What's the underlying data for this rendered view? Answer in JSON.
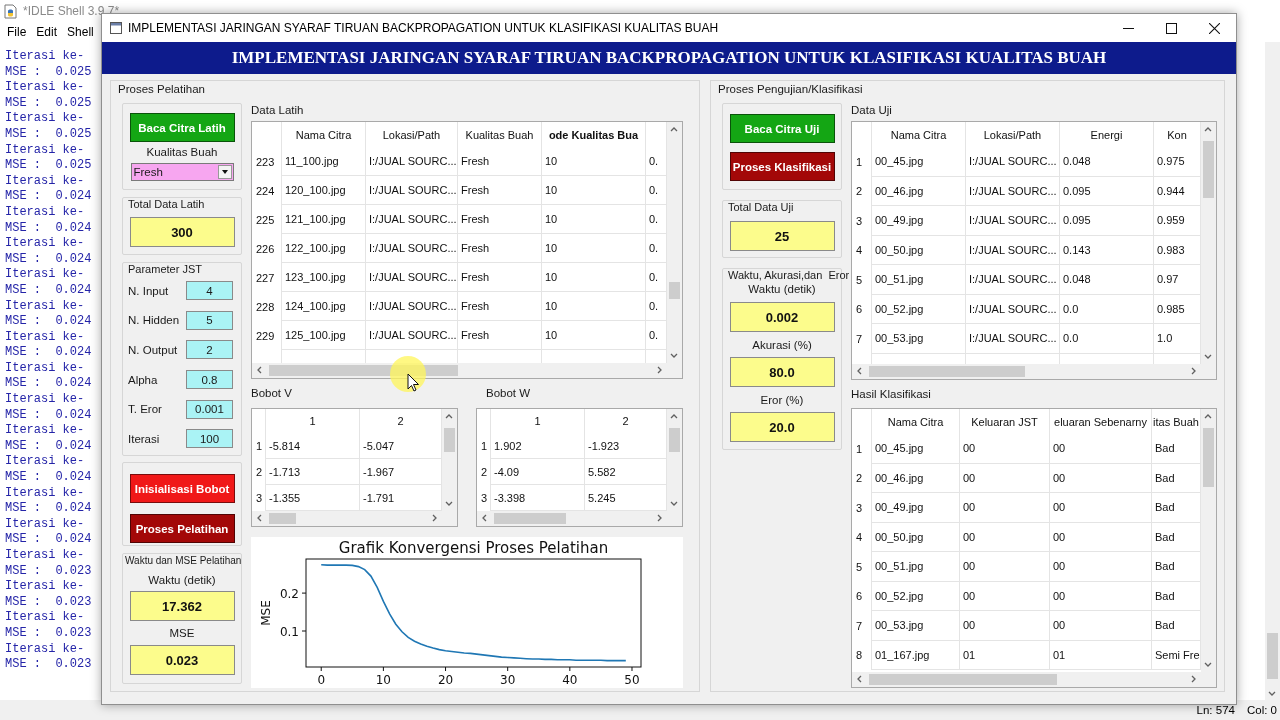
{
  "idle_window": {
    "title": "*IDLE Shell 3.9.7*",
    "menu": [
      "File",
      "Edit",
      "Shell"
    ],
    "output_lines": [
      "Iterasi ke-",
      "MSE :  0.025",
      "Iterasi ke-",
      "MSE :  0.025",
      "Iterasi ke-",
      "MSE :  0.025",
      "Iterasi ke-",
      "MSE :  0.025",
      "Iterasi ke-",
      "MSE :  0.024",
      "Iterasi ke-",
      "MSE :  0.024",
      "Iterasi ke-",
      "MSE :  0.024",
      "Iterasi ke-",
      "MSE :  0.024",
      "Iterasi ke-",
      "MSE :  0.024",
      "Iterasi ke-",
      "MSE :  0.024",
      "Iterasi ke-",
      "MSE :  0.024",
      "Iterasi ke-",
      "MSE :  0.024",
      "Iterasi ke-",
      "MSE :  0.024",
      "Iterasi ke-",
      "MSE :  0.024",
      "Iterasi ke-",
      "MSE :  0.024",
      "Iterasi ke-",
      "MSE :  0.024",
      "Iterasi ke-",
      "MSE :  0.023",
      "Iterasi ke-",
      "MSE :  0.023",
      "Iterasi ke-",
      "MSE :  0.023",
      "Iterasi ke-",
      "MSE :  0.023"
    ],
    "status_bar": [
      "Ln: 574",
      "Col: 0"
    ]
  },
  "window": {
    "title": "IMPLEMENTASI JARINGAN SYARAF TIRUAN BACKPROPAGATION UNTUK KLASIFIKASI KUALITAS BUAH",
    "banner": "IMPLEMENTASI JARINGAN SYARAF TIRUAN BACKPROPAGATION UNTUK KLASIFIKASI KUALITAS BUAH"
  },
  "training": {
    "title": "Proses Pelatihan",
    "buttons": [
      {
        "label": "Baca Citra Latih",
        "color": "#14a614"
      },
      {
        "label": "Inisialisasi Bobot",
        "color": "#f01818"
      },
      {
        "label": "Proses Pelatihan",
        "color": "#a30808"
      }
    ],
    "quality": {
      "label": "Kualitas Buah",
      "value": "Fresh"
    },
    "total": {
      "label": "Total Data Latih",
      "value": "300"
    },
    "parameters": {
      "title": "Parameter JST",
      "items": [
        {
          "label": "N. Input",
          "value": "4"
        },
        {
          "label": "N. Hidden",
          "value": "5"
        },
        {
          "label": "N. Output",
          "value": "2"
        },
        {
          "label": "Alpha",
          "value": "0.8"
        },
        {
          "label": "T. Eror",
          "value": "0.001"
        },
        {
          "label": "Iterasi",
          "value": "100"
        }
      ]
    },
    "results": {
      "title": "Waktu dan MSE Pelatihan",
      "items": [
        {
          "label": "Waktu (detik)",
          "value": "17.362"
        },
        {
          "label": "MSE",
          "value": "0.023"
        }
      ]
    },
    "data_table": {
      "title": "Data Latih",
      "columns": [
        {
          "label": "Nama Citra",
          "bold": false
        },
        {
          "label": "Lokasi/Path",
          "bold": false
        },
        {
          "label": "Kualitas Buah",
          "bold": false
        },
        {
          "label": "ode Kualitas Bua",
          "bold": true
        }
      ],
      "rows": [
        {
          "index": "223",
          "cells": [
            "11_100.jpg",
            "I:/JUAL SOURC...",
            "Fresh",
            "10",
            "0."
          ]
        },
        {
          "index": "224",
          "cells": [
            "120_100.jpg",
            "I:/JUAL SOURC...",
            "Fresh",
            "10",
            "0."
          ]
        },
        {
          "index": "225",
          "cells": [
            "121_100.jpg",
            "I:/JUAL SOURC...",
            "Fresh",
            "10",
            "0."
          ]
        },
        {
          "index": "226",
          "cells": [
            "122_100.jpg",
            "I:/JUAL SOURC...",
            "Fresh",
            "10",
            "0."
          ]
        },
        {
          "index": "227",
          "cells": [
            "123_100.jpg",
            "I:/JUAL SOURC...",
            "Fresh",
            "10",
            "0."
          ]
        },
        {
          "index": "228",
          "cells": [
            "124_100.jpg",
            "I:/JUAL SOURC...",
            "Fresh",
            "10",
            "0."
          ]
        },
        {
          "index": "229",
          "cells": [
            "125_100.jpg",
            "I:/JUAL SOURC...",
            "Fresh",
            "10",
            "0."
          ]
        }
      ]
    },
    "weights_v": {
      "title": "Bobot V",
      "columns": [
        {
          "label": "1",
          "bold": false
        },
        {
          "label": "2",
          "bold": false
        }
      ],
      "rows": [
        {
          "index": "1",
          "cells": [
            "-5.814",
            "-5.047"
          ]
        },
        {
          "index": "2",
          "cells": [
            "-1.713",
            "-1.967"
          ]
        },
        {
          "index": "3",
          "cells": [
            "-1.355",
            "-1.791"
          ]
        }
      ]
    },
    "weights_w": {
      "title": "Bobot W",
      "columns": [
        {
          "label": "1",
          "bold": false
        },
        {
          "label": "2",
          "bold": false
        }
      ],
      "rows": [
        {
          "index": "1",
          "cells": [
            "1.902",
            "-1.923"
          ]
        },
        {
          "index": "2",
          "cells": [
            "-4.09",
            "5.582"
          ]
        },
        {
          "index": "3",
          "cells": [
            "-3.398",
            "5.245"
          ]
        }
      ]
    },
    "chart": {
      "chart_data": {
        "type": "line",
        "title": "Grafik Konvergensi Proses Pelatihan",
        "ylabel": "MSE",
        "x": [
          0,
          1,
          2,
          3,
          4,
          5,
          6,
          7,
          8,
          9,
          10,
          11,
          12,
          13,
          14,
          15,
          16,
          17,
          18,
          19,
          20,
          21,
          22,
          23,
          24,
          25,
          26,
          27,
          28,
          29,
          30,
          31,
          32,
          33,
          34,
          35,
          36,
          37,
          38,
          39,
          40,
          41,
          42,
          43,
          44,
          45,
          46,
          47,
          48,
          49
        ],
        "xlim": [
          -2.45,
          51.45
        ],
        "ylim": [
          0.005,
          0.29
        ],
        "xticks": [
          0,
          10,
          20,
          30,
          40,
          50
        ],
        "yticks": [
          0.1,
          0.2
        ],
        "series": [
          {
            "color": "#1f77b4",
            "values": [
              0.275,
              0.274,
              0.274,
              0.274,
              0.274,
              0.273,
              0.27,
              0.262,
              0.245,
              0.215,
              0.178,
              0.145,
              0.118,
              0.098,
              0.083,
              0.073,
              0.066,
              0.06,
              0.055,
              0.051,
              0.048,
              0.046,
              0.044,
              0.042,
              0.041,
              0.039,
              0.037,
              0.035,
              0.033,
              0.031,
              0.03,
              0.029,
              0.028,
              0.027,
              0.026,
              0.026,
              0.025,
              0.025,
              0.024,
              0.024,
              0.024,
              0.023,
              0.023,
              0.023,
              0.023,
              0.023,
              0.022,
              0.022,
              0.022,
              0.022
            ]
          }
        ]
      }
    }
  },
  "testing": {
    "title": "Proses Pengujian/Klasifikasi",
    "buttons": [
      {
        "label": "Baca Citra Uji",
        "color": "#14a614"
      },
      {
        "label": "Proses Klasifikasi",
        "color": "#a30808"
      }
    ],
    "total": {
      "label": "Total Data Uji",
      "value": "25"
    },
    "results": {
      "title": "Waktu, Akurasi,dan  Eror",
      "items": [
        {
          "label": "Waktu (detik)",
          "value": "0.002"
        },
        {
          "label": "Akurasi (%)",
          "value": "80.0"
        },
        {
          "label": "Eror (%)",
          "value": "20.0"
        }
      ]
    },
    "data_table": {
      "title": "Data Uji",
      "columns": [
        {
          "label": "Nama Citra",
          "bold": false
        },
        {
          "label": "Lokasi/Path",
          "bold": false
        },
        {
          "label": "Energi",
          "bold": false
        },
        {
          "label": "Kon",
          "bold": false
        }
      ],
      "rows": [
        {
          "index": "1",
          "cells": [
            "00_45.jpg",
            "I:/JUAL SOURC...",
            "0.048",
            "0.975"
          ]
        },
        {
          "index": "2",
          "cells": [
            "00_46.jpg",
            "I:/JUAL SOURC...",
            "0.095",
            "0.944"
          ]
        },
        {
          "index": "3",
          "cells": [
            "00_49.jpg",
            "I:/JUAL SOURC...",
            "0.095",
            "0.959"
          ]
        },
        {
          "index": "4",
          "cells": [
            "00_50.jpg",
            "I:/JUAL SOURC...",
            "0.143",
            "0.983"
          ]
        },
        {
          "index": "5",
          "cells": [
            "00_51.jpg",
            "I:/JUAL SOURC...",
            "0.048",
            "0.97"
          ]
        },
        {
          "index": "6",
          "cells": [
            "00_52.jpg",
            "I:/JUAL SOURC...",
            "0.0",
            "0.985"
          ]
        },
        {
          "index": "7",
          "cells": [
            "00_53.jpg",
            "I:/JUAL SOURC...",
            "0.0",
            "1.0"
          ]
        }
      ]
    },
    "result_table": {
      "title": "Hasil Klasifikasi",
      "columns": [
        {
          "label": "Nama Citra",
          "bold": false
        },
        {
          "label": "Keluaran JST",
          "bold": false
        },
        {
          "label": "eluaran Sebenarny",
          "bold": false
        },
        {
          "label": "itas Buah",
          "bold": false
        }
      ],
      "rows": [
        {
          "index": "1",
          "cells": [
            "00_45.jpg",
            "00",
            "00",
            "Bad"
          ]
        },
        {
          "index": "2",
          "cells": [
            "00_46.jpg",
            "00",
            "00",
            "Bad"
          ]
        },
        {
          "index": "3",
          "cells": [
            "00_49.jpg",
            "00",
            "00",
            "Bad"
          ]
        },
        {
          "index": "4",
          "cells": [
            "00_50.jpg",
            "00",
            "00",
            "Bad"
          ]
        },
        {
          "index": "5",
          "cells": [
            "00_51.jpg",
            "00",
            "00",
            "Bad"
          ]
        },
        {
          "index": "6",
          "cells": [
            "00_52.jpg",
            "00",
            "00",
            "Bad"
          ]
        },
        {
          "index": "7",
          "cells": [
            "00_53.jpg",
            "00",
            "00",
            "Bad"
          ]
        },
        {
          "index": "8",
          "cells": [
            "01_167.jpg",
            "01",
            "01",
            "Semi Fre"
          ]
        }
      ]
    }
  }
}
